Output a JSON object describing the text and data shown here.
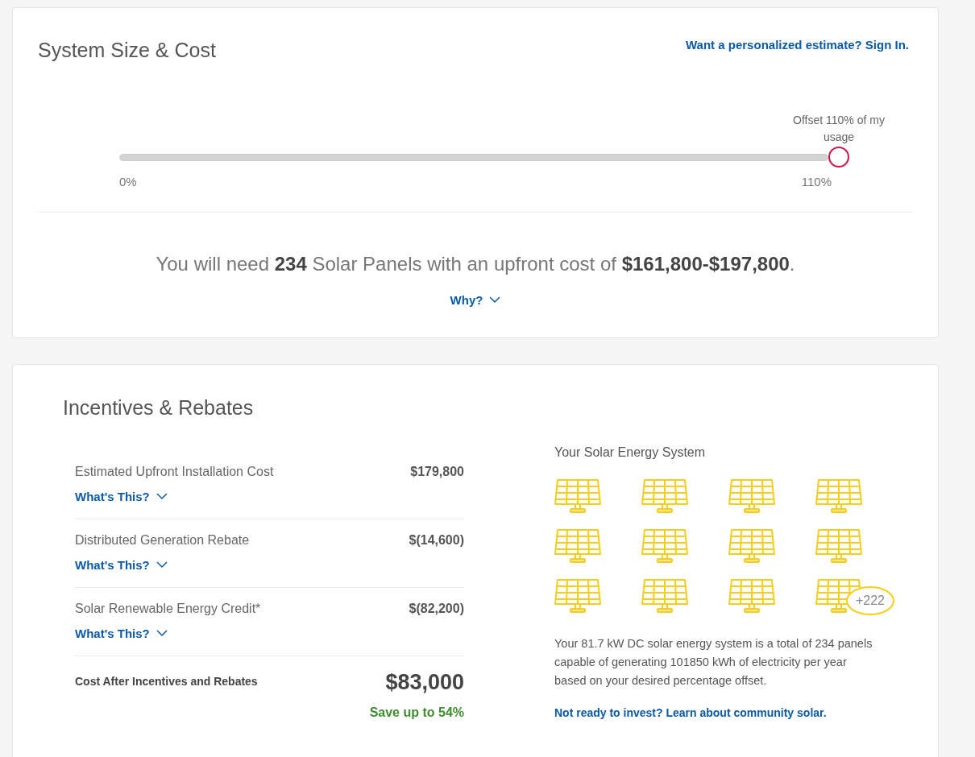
{
  "system_size": {
    "title": "System Size & Cost",
    "sign_in_link": "Want a personalized estimate? Sign In.",
    "slider": {
      "caption": "Offset 110% of my usage",
      "level": 1,
      "min_label": "0%",
      "max_label": "110%"
    },
    "summary": "You will need **234** Solar Panels with an upfront cost of **$161,800-$197,800**.",
    "why_link": "Why?"
  },
  "incentives": {
    "title": "Incentives & Rebates",
    "rows": [
      {
        "label": "Estimated Upfront Installation Cost",
        "amount": "$179,800",
        "link": "What's This?"
      },
      {
        "label": "Distributed Generation Rebate",
        "amount": "$(14,600)",
        "link": "What's This?"
      },
      {
        "label": "Solar Renewable Energy Credit*",
        "amount": "$(82,200)",
        "link": "What's This?"
      }
    ],
    "total": {
      "label": "Cost After Incentives and Rebates",
      "amount": "$83,000",
      "savings": "Save up to 54%"
    }
  },
  "energy_system": {
    "title": "Your Solar Energy System",
    "more_badge": "+222",
    "description": "Your 81.7 kW DC solar energy system is a total of 234 panels capable of generating 101850 kWh of electricity per year based on your desired percentage offset.",
    "community_link": "Not ready to invest? Learn about community solar."
  }
}
